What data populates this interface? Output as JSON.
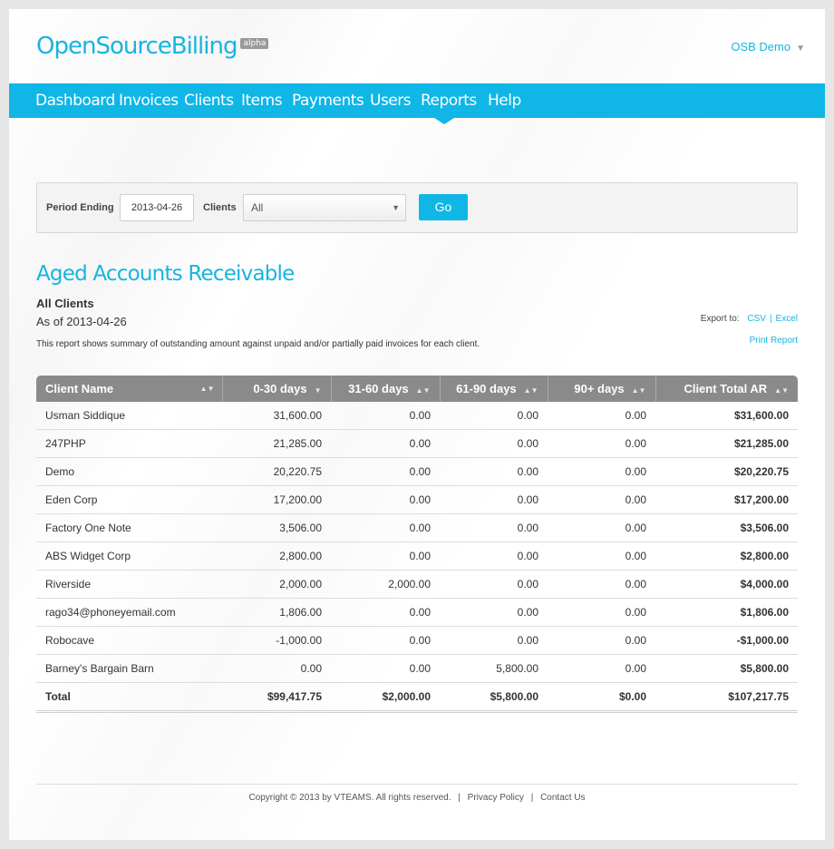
{
  "brand": {
    "name": "OpenSourceBilling",
    "badge": "alpha"
  },
  "user_menu": {
    "label": "OSB Demo"
  },
  "nav": {
    "items": [
      "Dashboard",
      "Invoices",
      "Clients",
      "Items",
      "Payments",
      "Users",
      "Reports",
      "Help"
    ],
    "active": "Reports"
  },
  "filters": {
    "period_label": "Period Ending",
    "period_value": "2013-04-26",
    "clients_label": "Clients",
    "clients_value": "All",
    "go_label": "Go"
  },
  "report": {
    "title": "Aged Accounts Receivable",
    "subtitle": "All Clients",
    "as_of": "As of 2013-04-26",
    "description": "This report shows summary of outstanding amount against unpaid and/or partially paid invoices for each client.",
    "export_label": "Export to:",
    "export_csv": "CSV",
    "export_excel": "Excel",
    "print_label": "Print Report"
  },
  "table": {
    "columns": [
      "Client Name",
      "0-30 days",
      "31-60 days",
      "61-90 days",
      "90+ days",
      "Client Total AR"
    ],
    "rows": [
      [
        "Usman Siddique",
        "31,600.00",
        "0.00",
        "0.00",
        "0.00",
        "$31,600.00"
      ],
      [
        "247PHP",
        "21,285.00",
        "0.00",
        "0.00",
        "0.00",
        "$21,285.00"
      ],
      [
        "Demo",
        "20,220.75",
        "0.00",
        "0.00",
        "0.00",
        "$20,220.75"
      ],
      [
        "Eden Corp",
        "17,200.00",
        "0.00",
        "0.00",
        "0.00",
        "$17,200.00"
      ],
      [
        "Factory One Note",
        "3,506.00",
        "0.00",
        "0.00",
        "0.00",
        "$3,506.00"
      ],
      [
        "ABS Widget Corp",
        "2,800.00",
        "0.00",
        "0.00",
        "0.00",
        "$2,800.00"
      ],
      [
        "Riverside",
        "2,000.00",
        "2,000.00",
        "0.00",
        "0.00",
        "$4,000.00"
      ],
      [
        "rago34@phoneyemail.com",
        "1,806.00",
        "0.00",
        "0.00",
        "0.00",
        "$1,806.00"
      ],
      [
        "Robocave",
        "-1,000.00",
        "0.00",
        "0.00",
        "0.00",
        "-$1,000.00"
      ],
      [
        "Barney's Bargain Barn",
        "0.00",
        "0.00",
        "5,800.00",
        "0.00",
        "$5,800.00"
      ]
    ],
    "total": [
      "Total",
      "$99,417.75",
      "$2,000.00",
      "$5,800.00",
      "$0.00",
      "$107,217.75"
    ]
  },
  "footer": {
    "copyright": "Copyright © 2013 by VTEAMS. All rights reserved.",
    "privacy": "Privacy Policy",
    "contact": "Contact Us"
  },
  "colors": {
    "accent": "#0fb6e6",
    "header_gray": "#8a8a8a"
  }
}
